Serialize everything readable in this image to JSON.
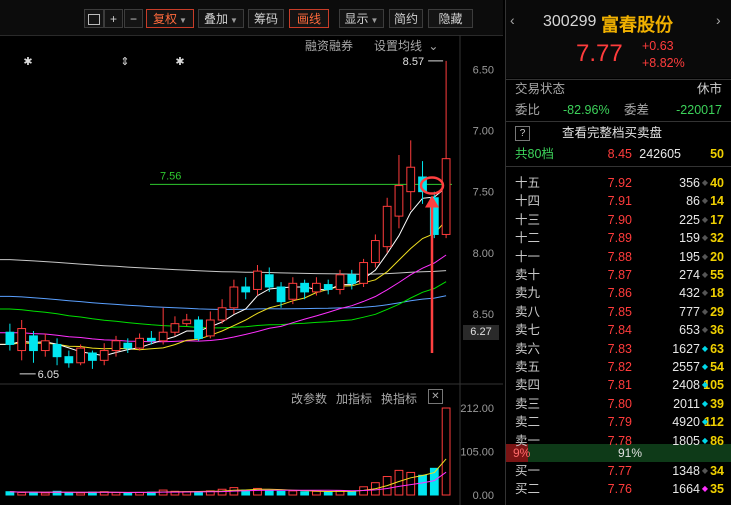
{
  "toolbar": {
    "items": [
      {
        "label": "+",
        "active": false
      },
      {
        "label": "−",
        "active": false
      },
      {
        "label": "复权",
        "active": true,
        "dropdown": true
      },
      {
        "label": "叠加",
        "active": false,
        "dropdown": true
      },
      {
        "label": "筹码",
        "active": false
      },
      {
        "label": "画线",
        "active": true
      },
      {
        "label": "显示",
        "active": false,
        "dropdown": true
      },
      {
        "label": "简约",
        "active": false
      },
      {
        "label": "隐藏",
        "active": false
      }
    ]
  },
  "chart": {
    "links": {
      "margin": "融资融券",
      "ma_settings": "设置均线",
      "chevron": "⌄"
    },
    "high_label": "8.57",
    "low_label": "6.05",
    "ref_line_label": "7.56",
    "current_price_tag": "6.27",
    "y_ticks": [
      "8.50",
      "8.00",
      "7.50",
      "7.00",
      "6.50"
    ],
    "volume_tools": {
      "change_params": "改参数",
      "add_indicator": "加指标",
      "switch_indicator": "换指标",
      "close": "✕"
    },
    "volume_ticks": [
      "212.00",
      "105.00",
      "0.00"
    ],
    "colors": {
      "up": "#ff3c3c",
      "down": "#00e6f0",
      "ref_line": "#2ec82e",
      "ma5": "#ffffff",
      "ma10": "#f0e020",
      "ma20": "#ff30ff",
      "ma30": "#00e000",
      "ma60": "#5aa0ff",
      "ma120": "#c8c8c8"
    }
  },
  "chart_data": {
    "type": "candlestick",
    "title": "",
    "xlabel": "",
    "ylabel": "",
    "ylim": [
      6.0,
      8.7
    ],
    "y_ticks": [
      6.5,
      7.0,
      7.5,
      8.0,
      8.5
    ],
    "annotations": [
      {
        "text": "8.57",
        "value": 8.57,
        "kind": "high"
      },
      {
        "text": "6.05",
        "value": 6.05,
        "kind": "low"
      },
      {
        "text": "7.56",
        "value": 7.56,
        "kind": "horizontal-line"
      }
    ],
    "candles": [
      {
        "o": 6.35,
        "c": 6.25,
        "h": 6.42,
        "l": 6.2
      },
      {
        "o": 6.2,
        "c": 6.38,
        "h": 6.45,
        "l": 6.12
      },
      {
        "o": 6.32,
        "c": 6.2,
        "h": 6.36,
        "l": 6.1
      },
      {
        "o": 6.2,
        "c": 6.28,
        "h": 6.34,
        "l": 6.15
      },
      {
        "o": 6.25,
        "c": 6.15,
        "h": 6.3,
        "l": 6.08
      },
      {
        "o": 6.15,
        "c": 6.1,
        "h": 6.2,
        "l": 6.06
      },
      {
        "o": 6.1,
        "c": 6.22,
        "h": 6.25,
        "l": 6.08
      },
      {
        "o": 6.18,
        "c": 6.12,
        "h": 6.2,
        "l": 6.05
      },
      {
        "o": 6.12,
        "c": 6.2,
        "h": 6.26,
        "l": 6.08
      },
      {
        "o": 6.2,
        "c": 6.28,
        "h": 6.32,
        "l": 6.15
      },
      {
        "o": 6.26,
        "c": 6.22,
        "h": 6.3,
        "l": 6.18
      },
      {
        "o": 6.22,
        "c": 6.3,
        "h": 6.34,
        "l": 6.2
      },
      {
        "o": 6.3,
        "c": 6.28,
        "h": 6.36,
        "l": 6.25
      },
      {
        "o": 6.28,
        "c": 6.35,
        "h": 6.55,
        "l": 6.25
      },
      {
        "o": 6.35,
        "c": 6.42,
        "h": 6.48,
        "l": 6.32
      },
      {
        "o": 6.42,
        "c": 6.45,
        "h": 6.5,
        "l": 6.4
      },
      {
        "o": 6.45,
        "c": 6.3,
        "h": 6.48,
        "l": 6.28
      },
      {
        "o": 6.32,
        "c": 6.45,
        "h": 6.52,
        "l": 6.3
      },
      {
        "o": 6.45,
        "c": 6.55,
        "h": 6.62,
        "l": 6.42
      },
      {
        "o": 6.55,
        "c": 6.72,
        "h": 6.78,
        "l": 6.5
      },
      {
        "o": 6.72,
        "c": 6.68,
        "h": 6.8,
        "l": 6.62
      },
      {
        "o": 6.7,
        "c": 6.85,
        "h": 6.9,
        "l": 6.65
      },
      {
        "o": 6.82,
        "c": 6.72,
        "h": 6.88,
        "l": 6.68
      },
      {
        "o": 6.72,
        "c": 6.6,
        "h": 6.76,
        "l": 6.55
      },
      {
        "o": 6.62,
        "c": 6.75,
        "h": 6.8,
        "l": 6.58
      },
      {
        "o": 6.75,
        "c": 6.68,
        "h": 6.78,
        "l": 6.62
      },
      {
        "o": 6.68,
        "c": 6.75,
        "h": 6.8,
        "l": 6.65
      },
      {
        "o": 6.74,
        "c": 6.7,
        "h": 6.78,
        "l": 6.66
      },
      {
        "o": 6.7,
        "c": 6.82,
        "h": 6.86,
        "l": 6.66
      },
      {
        "o": 6.82,
        "c": 6.75,
        "h": 6.86,
        "l": 6.7
      },
      {
        "o": 6.75,
        "c": 6.92,
        "h": 6.95,
        "l": 6.72
      },
      {
        "o": 6.92,
        "c": 7.1,
        "h": 7.15,
        "l": 6.88
      },
      {
        "o": 7.05,
        "c": 7.38,
        "h": 7.45,
        "l": 7.0
      },
      {
        "o": 7.3,
        "c": 7.55,
        "h": 7.8,
        "l": 7.2
      },
      {
        "o": 7.5,
        "c": 7.7,
        "h": 7.92,
        "l": 7.35
      },
      {
        "o": 7.62,
        "c": 7.5,
        "h": 7.75,
        "l": 7.4
      },
      {
        "o": 7.45,
        "c": 7.15,
        "h": 7.5,
        "l": 7.12
      },
      {
        "o": 7.15,
        "c": 7.77,
        "h": 8.57,
        "l": 7.12
      }
    ],
    "volume": [
      8,
      6,
      7,
      5,
      9,
      6,
      5,
      7,
      8,
      6,
      5,
      6,
      7,
      12,
      9,
      8,
      7,
      10,
      14,
      18,
      12,
      16,
      11,
      9,
      10,
      8,
      9,
      7,
      11,
      9,
      20,
      30,
      45,
      60,
      55,
      48,
      65,
      212
    ],
    "volume_ylim": [
      0,
      212
    ]
  },
  "quote": {
    "code": "300299",
    "name": "富春股份",
    "price": "7.77",
    "change": "+0.63",
    "change_pct": "+8.82%",
    "trade_status_label": "交易状态",
    "trade_status": "休市",
    "weibi_label": "委比",
    "weibi": "-82.96%",
    "weicha_label": "委差",
    "weicha": "-220017",
    "full_depth_icon": "?",
    "full_depth_label": "查看完整档买卖盘",
    "total_levels_label": "共80档",
    "total_levels_price": "8.45",
    "total_levels_vol": "242605",
    "total_levels_cnt": "50",
    "asks": [
      {
        "label": "十五",
        "price": "7.92",
        "vol": "356",
        "cnt": "40",
        "mark": "gray"
      },
      {
        "label": "十四",
        "price": "7.91",
        "vol": "86",
        "cnt": "14",
        "mark": "gray"
      },
      {
        "label": "十三",
        "price": "7.90",
        "vol": "225",
        "cnt": "17",
        "mark": "gray"
      },
      {
        "label": "十二",
        "price": "7.89",
        "vol": "159",
        "cnt": "32",
        "mark": "gray"
      },
      {
        "label": "十一",
        "price": "7.88",
        "vol": "195",
        "cnt": "20",
        "mark": "gray"
      },
      {
        "label": "卖十",
        "price": "7.87",
        "vol": "274",
        "cnt": "55",
        "mark": "gray"
      },
      {
        "label": "卖九",
        "price": "7.86",
        "vol": "432",
        "cnt": "18",
        "mark": "gray"
      },
      {
        "label": "卖八",
        "price": "7.85",
        "vol": "777",
        "cnt": "29",
        "mark": "gray"
      },
      {
        "label": "卖七",
        "price": "7.84",
        "vol": "653",
        "cnt": "36",
        "mark": "gray"
      },
      {
        "label": "卖六",
        "price": "7.83",
        "vol": "1627",
        "cnt": "63",
        "mark": "cyan"
      },
      {
        "label": "卖五",
        "price": "7.82",
        "vol": "2557",
        "cnt": "54",
        "mark": "cyan"
      },
      {
        "label": "卖四",
        "price": "7.81",
        "vol": "2408",
        "cnt": "105",
        "mark": "cyan"
      },
      {
        "label": "卖三",
        "price": "7.80",
        "vol": "2011",
        "cnt": "39",
        "mark": "cyan"
      },
      {
        "label": "卖二",
        "price": "7.79",
        "vol": "4920",
        "cnt": "112",
        "mark": "cyan"
      },
      {
        "label": "卖一",
        "price": "7.78",
        "vol": "1805",
        "cnt": "86",
        "mark": "cyan"
      }
    ],
    "ratio_left": "9%",
    "ratio_right": "91%",
    "bids": [
      {
        "label": "买一",
        "price": "7.77",
        "vol": "1348",
        "cnt": "34",
        "mark": "gray"
      },
      {
        "label": "买二",
        "price": "7.76",
        "vol": "1664",
        "cnt": "35",
        "mark": "magenta"
      }
    ]
  }
}
